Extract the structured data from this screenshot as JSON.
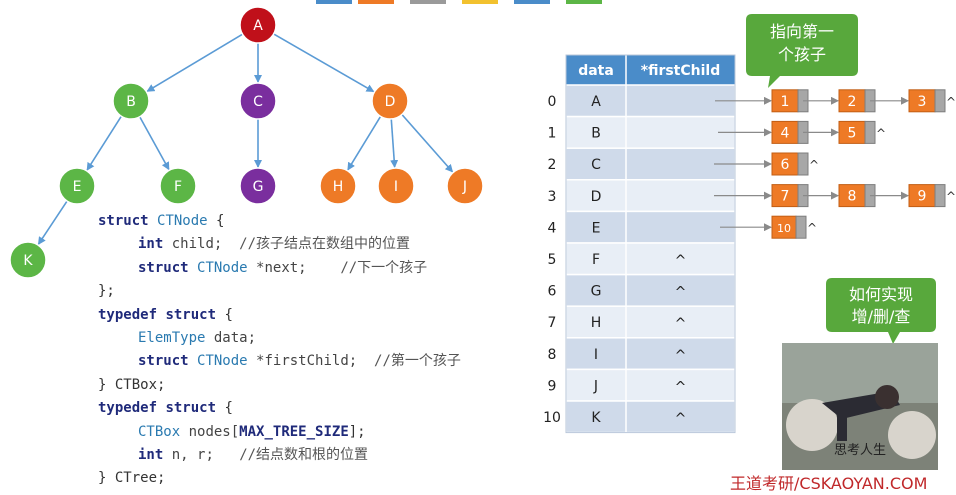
{
  "tree": {
    "nodes": [
      {
        "label": "A",
        "color": "#c0101a"
      },
      {
        "label": "B",
        "color": "#5cb646"
      },
      {
        "label": "C",
        "color": "#7a2e9e"
      },
      {
        "label": "D",
        "color": "#ee7a26"
      },
      {
        "label": "E",
        "color": "#5cb646"
      },
      {
        "label": "F",
        "color": "#5cb646"
      },
      {
        "label": "G",
        "color": "#7a2e9e"
      },
      {
        "label": "H",
        "color": "#ee7a26"
      },
      {
        "label": "I",
        "color": "#ee7a26"
      },
      {
        "label": "J",
        "color": "#ee7a26"
      },
      {
        "label": "K",
        "color": "#5cb646"
      }
    ],
    "edges": [
      [
        "A",
        "B"
      ],
      [
        "A",
        "C"
      ],
      [
        "A",
        "D"
      ],
      [
        "B",
        "E"
      ],
      [
        "B",
        "F"
      ],
      [
        "C",
        "G"
      ],
      [
        "D",
        "H"
      ],
      [
        "D",
        "I"
      ],
      [
        "D",
        "J"
      ],
      [
        "E",
        "K"
      ]
    ],
    "edge_color": "#5b9bd5"
  },
  "code": {
    "struct": "struct",
    "ctnode": "CTNode",
    "brace_open": "{",
    "int": "int",
    "child": "child;",
    "comment_child": "//孩子结点在数组中的位置",
    "struct2": "struct",
    "ctnode2": "CTNode",
    "next": "*next;",
    "comment_next": "//下一个孩子",
    "close1": "};",
    "typedef": "typedef",
    "struct3": "struct",
    "brace_open2": "{",
    "elemtype": "ElemType",
    "data": "data;",
    "struct4": "struct",
    "ctnode3": "CTNode",
    "firstchild": "*firstChild;",
    "comment_first": "//第一个孩子",
    "close2": "} CTBox;",
    "typedef2": "typedef",
    "struct5": "struct",
    "brace_open3": "{",
    "ctbox": "CTBox",
    "nodes": "nodes[",
    "maxsize": "MAX_TREE_SIZE",
    "nodes_end": "];",
    "int2": "int",
    "nr": "n, r;",
    "comment_nr": "//结点数和根的位置",
    "close3": "} CTree;"
  },
  "table": {
    "header_data": "data",
    "header_first": "*firstChild",
    "header_color": "#4a8cc9",
    "rows": [
      {
        "index": "0",
        "data": "A",
        "first": ""
      },
      {
        "index": "1",
        "data": "B",
        "first": ""
      },
      {
        "index": "2",
        "data": "C",
        "first": ""
      },
      {
        "index": "3",
        "data": "D",
        "first": ""
      },
      {
        "index": "4",
        "data": "E",
        "first": ""
      },
      {
        "index": "5",
        "data": "F",
        "first": "^"
      },
      {
        "index": "6",
        "data": "G",
        "first": "^"
      },
      {
        "index": "7",
        "data": "H",
        "first": "^"
      },
      {
        "index": "8",
        "data": "I",
        "first": "^"
      },
      {
        "index": "9",
        "data": "J",
        "first": "^"
      },
      {
        "index": "10",
        "data": "K",
        "first": "^"
      }
    ]
  },
  "lists": [
    [
      "1",
      "2",
      "3"
    ],
    [
      "4",
      "5"
    ],
    [
      "6"
    ],
    [
      "7",
      "8",
      "9"
    ],
    [
      "10"
    ]
  ],
  "list_null": "^",
  "list_node_color": "#ee7a26",
  "callout1": {
    "line1": "指向第一",
    "line2": "个孩子",
    "color": "#58a83c"
  },
  "callout2": {
    "line1": "如何实现",
    "line2": "增/删/查",
    "color": "#58a83c"
  },
  "photo_caption": "思考人生",
  "stamp": "王道考研/CSKAOYAN.COM"
}
